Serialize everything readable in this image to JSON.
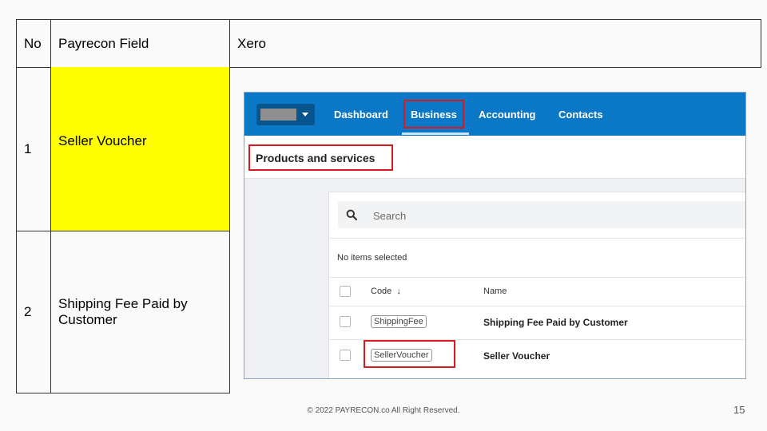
{
  "table": {
    "headers": [
      "No",
      "Payrecon Field",
      "Xero"
    ],
    "rows": [
      {
        "no": "1",
        "field": "Seller Voucher"
      },
      {
        "no": "2",
        "field": "Shipping Fee Paid by Customer"
      }
    ]
  },
  "xero": {
    "nav": [
      "Dashboard",
      "Business",
      "Accounting",
      "Contacts"
    ],
    "active_nav": "Business",
    "page_title": "Products and services",
    "search": {
      "placeholder": "Search"
    },
    "selection_status": "No items selected",
    "columns": {
      "code": "Code",
      "name": "Name",
      "sort_icon": "arrow-down-icon"
    },
    "items": [
      {
        "code": "ShippingFee",
        "name": "Shipping Fee Paid by Customer"
      },
      {
        "code": "SellerVoucher",
        "name": "Seller Voucher"
      }
    ],
    "colors": {
      "nav_bg": "#0b78c7",
      "highlight": "#d9191f"
    }
  },
  "colors": {
    "field_highlight": "#ffff00"
  },
  "footer": {
    "copyright": "© 2022 PAYRECON.co All Right Reserved.",
    "page_number": "15"
  }
}
